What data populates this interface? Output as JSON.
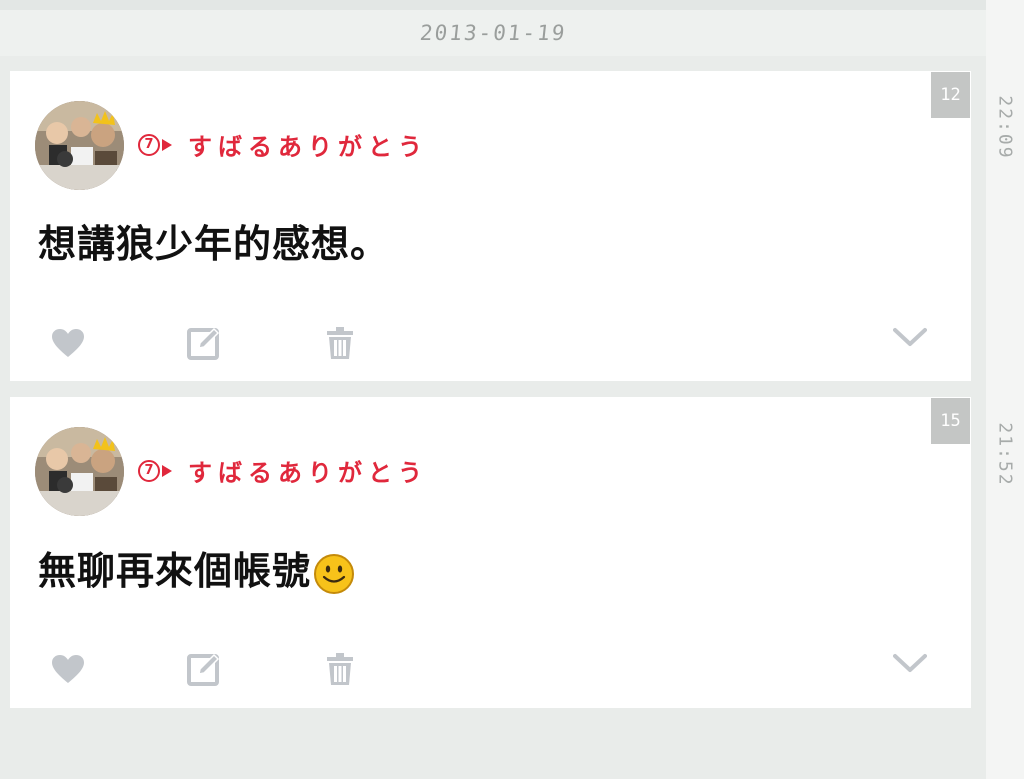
{
  "date_header": "2013-01-19",
  "posts": [
    {
      "time": "22:09",
      "count": "12",
      "author": {
        "number": "7",
        "name": "すばるありがとう"
      },
      "text": "想講狼少年的感想。",
      "emoji": null,
      "actions": [
        "heart-icon",
        "edit-icon",
        "trash-icon",
        "chevron-down-icon"
      ]
    },
    {
      "time": "21:52",
      "count": "15",
      "author": {
        "number": "7",
        "name": "すばるありがとう"
      },
      "text": "無聊再來個帳號",
      "emoji": "smiley-emoji-icon",
      "actions": [
        "heart-icon",
        "edit-icon",
        "trash-icon",
        "chevron-down-icon"
      ]
    }
  ],
  "colors": {
    "accent_red": "#e0283c",
    "icon_gray": "#c2c6cb",
    "badge_gray": "#c4c6c5",
    "background": "#e9ecea"
  }
}
